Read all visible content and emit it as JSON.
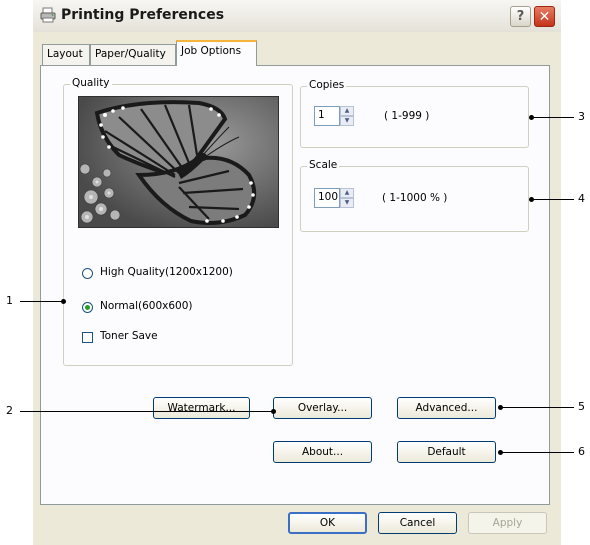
{
  "window": {
    "title": "Printing Preferences",
    "help_glyph": "?",
    "close_glyph": "✕"
  },
  "tabs": [
    {
      "label": "Layout"
    },
    {
      "label": "Paper/Quality"
    },
    {
      "label": "Job Options",
      "active": true
    }
  ],
  "quality": {
    "label": "Quality",
    "options": [
      {
        "label": "High Quality(1200x1200)",
        "selected": false
      },
      {
        "label": "Normal(600x600)",
        "selected": true
      }
    ],
    "toner_save": {
      "label": "Toner Save",
      "checked": false
    }
  },
  "copies": {
    "label": "Copies",
    "value": "1",
    "range": "( 1-999 )"
  },
  "scale": {
    "label": "Scale",
    "value": "100",
    "range": "( 1-1000 % )"
  },
  "buttons": {
    "watermark": "Watermark...",
    "overlay": "Overlay...",
    "advanced": "Advanced...",
    "about": "About...",
    "default": "Default",
    "ok": "OK",
    "cancel": "Cancel",
    "apply": "Apply"
  },
  "callouts": [
    "1",
    "2",
    "3",
    "4",
    "5",
    "6"
  ],
  "icons": {
    "printer": "printer-icon",
    "help": "help-icon",
    "close": "close-icon",
    "preview": "butterfly-image"
  }
}
